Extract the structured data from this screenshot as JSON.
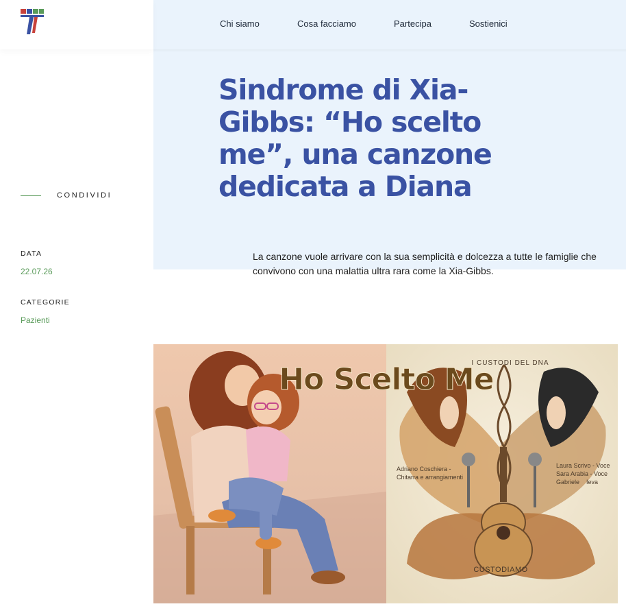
{
  "nav": {
    "items": [
      {
        "label": "Chi siamo"
      },
      {
        "label": "Cosa facciamo"
      },
      {
        "label": "Partecipa"
      },
      {
        "label": "Sostienici"
      }
    ]
  },
  "article": {
    "title": "Sindrome di Xia-Gibbs: “Ho scelto me”, una canzone dedicata a Diana",
    "lead": "La canzone vuole arrivare con la sua semplicità e dolcezza a tutte le famiglie che convivono con una malattia ultra rara come la Xia-Gibbs."
  },
  "sidebar": {
    "share_label": "CONDIVIDI",
    "date_label": "DATA",
    "date_value": "22.07.26",
    "categories_label": "CATEGORIE",
    "category_value": "Pazienti"
  },
  "cover": {
    "headline": "Ho Scelto Me",
    "band": "I CUSTODI DEL DNA",
    "credit_left_1": "Adriano Coschiera -",
    "credit_left_2": "Chitarra e arrangiamenti",
    "credit_right_1": "Laura Scrivo - Voce",
    "credit_right_2": "Sara Arabia - Voce",
    "credit_right_3": "Gabriele",
    "credit_right_4": "Ieva",
    "footer": "CUSTODIAMO"
  },
  "colors": {
    "title_blue": "#3a52a3",
    "accent_green": "#5a9b5a",
    "hero_bg": "#eaf3fc"
  },
  "icons": {
    "logo": "organization-logo"
  }
}
